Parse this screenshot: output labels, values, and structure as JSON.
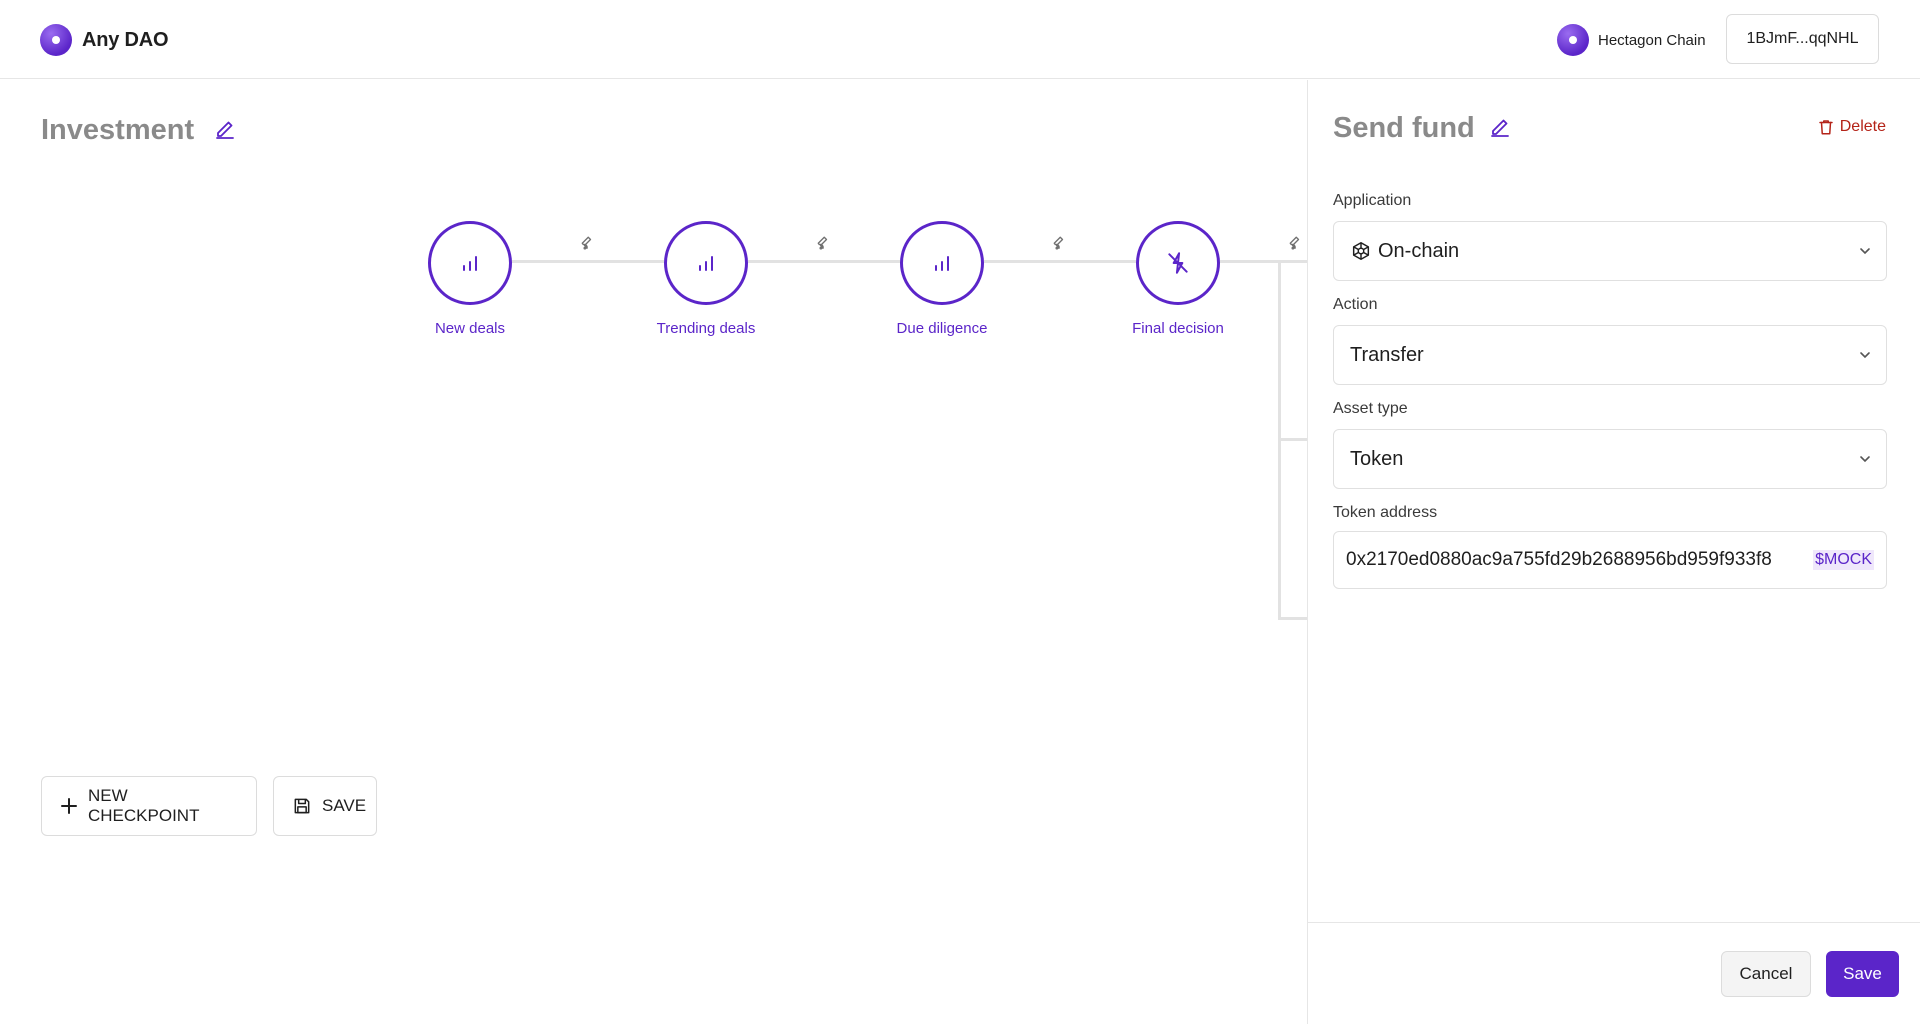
{
  "header": {
    "brand": "Any DAO",
    "chain_name": "Hectagon Chain",
    "wallet_address": "1BJmF...qqNHL"
  },
  "workflow": {
    "title": "Investment",
    "checkpoints": [
      {
        "label": "New deals",
        "icon": "bar-chart-icon"
      },
      {
        "label": "Trending deals",
        "icon": "bar-chart-icon"
      },
      {
        "label": "Due diligence",
        "icon": "bar-chart-icon"
      },
      {
        "label": "Final decision",
        "icon": "flash-off-icon"
      }
    ],
    "new_checkpoint_label": "NEW CHECKPOINT",
    "save_label": "SAVE"
  },
  "panel": {
    "title": "Send fund",
    "delete_label": "Delete",
    "application": {
      "label": "Application",
      "value": "On-chain"
    },
    "action": {
      "label": "Action",
      "value": "Transfer"
    },
    "asset_type": {
      "label": "Asset type",
      "value": "Token"
    },
    "token_address": {
      "label": "Token address",
      "value": "0x2170ed0880ac9a755fd29b2688956bd959f933f8",
      "symbol": "$MOCK"
    },
    "cancel_label": "Cancel",
    "save_label": "Save"
  },
  "colors": {
    "accent": "#5b25c9",
    "danger": "#b42318",
    "muted_title": "#8a8a8a"
  }
}
